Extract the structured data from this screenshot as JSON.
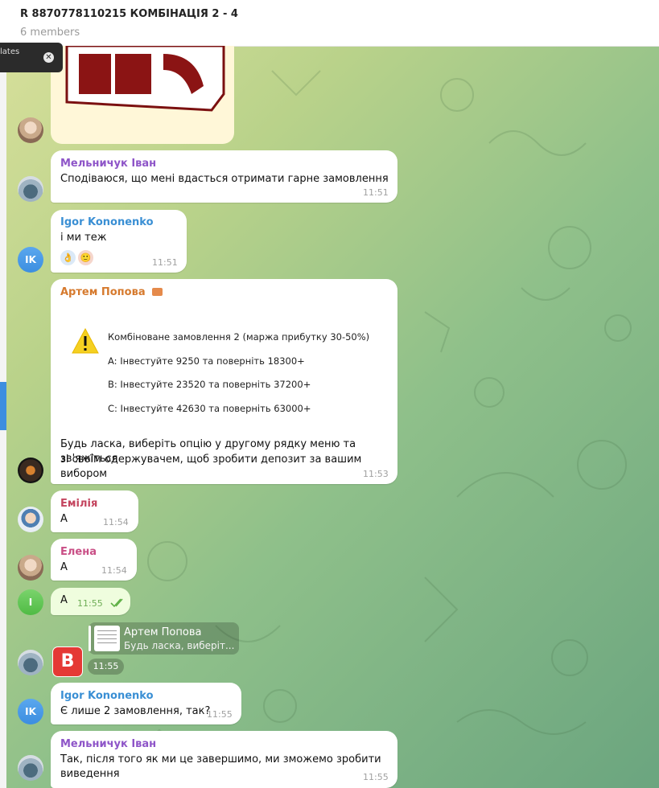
{
  "header": {
    "title": "R 8870778110215 КОМБІНАЦІЯ 2 - 4",
    "subtitle": "6 members"
  },
  "toast": {
    "text": "lates"
  },
  "colors": {
    "igor": "#3a8fd4",
    "melnychuk": "#8e55c8",
    "artem": "#d67a2e",
    "emilia": "#c4455f",
    "elena": "#c94f86"
  },
  "messages": [
    {
      "author": "Мельничук Іван",
      "text": "Сподіваюся, що мені вдасться отримати гарне замовлення",
      "time": "11:51"
    },
    {
      "author": "Igor Kononenko",
      "text": "і ми теж",
      "time": "11:51",
      "reactions": [
        "👌",
        "🙂"
      ]
    },
    {
      "author": "Артем Попова",
      "text_line1": "Будь ласка, виберіть опцію у другому рядку меню та зв'яжіться",
      "text_line2": "зі своїм одержувачем, щоб зробити депозит за вашим вибором",
      "time": "11:53",
      "card": {
        "title": "Комбіноване замовлення 2 (маржа прибутку 30-50%)",
        "lines": [
          "A: Інвестуйте 9250  та поверніть  18300+",
          "B: Інвестуйте  23520  та поверніть 37200+",
          "C: Інвестуйте  42630 та поверніть  63000+"
        ]
      }
    },
    {
      "author": "Емілія",
      "text": "А",
      "time": "11:54"
    },
    {
      "author": "Елена",
      "text": "А",
      "time": "11:54"
    },
    {
      "author": "I",
      "text": "А",
      "time": "11:55",
      "own": true
    },
    {
      "reply_name": "Артем Попова",
      "reply_text": "Будь ласка, виберіт...",
      "sticker": "B",
      "time": "11:55"
    },
    {
      "author": "Igor Kononenko",
      "text": "Є лише 2 замовлення, так?",
      "time": "11:55"
    },
    {
      "author": "Мельничук Іван",
      "text_line1": "Так, після того як ми це завершимо, ми зможемо зробити",
      "text_line2": "виведення",
      "time": "11:55"
    }
  ],
  "avatars": {
    "ik": "IK",
    "i": "I"
  },
  "icons": [
    "close-icon",
    "warning-icon",
    "briefcase-icon",
    "double-check-icon"
  ]
}
